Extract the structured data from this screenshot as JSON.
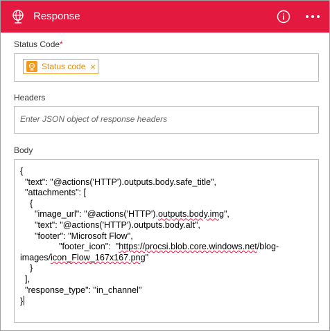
{
  "header": {
    "title": "Response",
    "background": "#e3193f"
  },
  "status_code": {
    "label": "Status Code",
    "required_mark": "*",
    "token": {
      "icon": "globe-icon",
      "text": "Status code",
      "remove": "×"
    }
  },
  "headers": {
    "label": "Headers",
    "placeholder": "Enter JSON object of response headers"
  },
  "body": {
    "label": "Body",
    "lines": {
      "l1": "{",
      "l2": "  \"text\": \"@actions('HTTP').outputs.body.safe_title\",",
      "l3": "  \"attachments\": [",
      "l4": "    {",
      "l5a": "      \"image_url\": \"@actions('HTTP').",
      "l5b": "outputs.body.img",
      "l5c": "\",",
      "l6": "      \"text\": \"@actions('HTTP').outputs.body.alt\",",
      "l7": "      \"footer\": \"Microsoft Flow\",",
      "l8a": "                \"footer_icon\":  \"",
      "l8b": "https://procsi.blob.core.windows.net",
      "l8c": "/blog-",
      "l9a": "images/",
      "l9b": "icon_Flow_167x167.png",
      "l9c": "\"",
      "l10": "    }",
      "l11": "  ],",
      "l12": "  \"response_type\": \"in_channel\"",
      "l13": "}"
    }
  }
}
